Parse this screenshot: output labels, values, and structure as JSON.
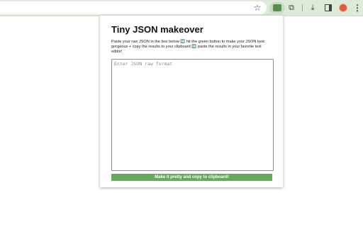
{
  "browser": {
    "icons": [
      "star-icon",
      "extension-icon",
      "puzzle-icon",
      "download-icon",
      "side-panel-icon",
      "avatar",
      "more-menu-icon"
    ],
    "star_glyph": "☆",
    "puzzle_glyph": "⧉",
    "download_glyph": "⤓",
    "menu_glyph": "⋮"
  },
  "popup": {
    "title": "Tiny JSON makeover",
    "instructions": "Paste your raw JSON in the box below ➡️ hit the green button to make your JSON look gorgeous + copy the results to your clipboard ➡️ paste the results in your favorite text editor!",
    "input": {
      "placeholder": "Enter JSON raw format",
      "value": ""
    },
    "button_label": "Make it pretty and copy to clipboard!"
  },
  "colors": {
    "button_green": "#67a95c",
    "toolbar_bg": "#dcebd8"
  }
}
